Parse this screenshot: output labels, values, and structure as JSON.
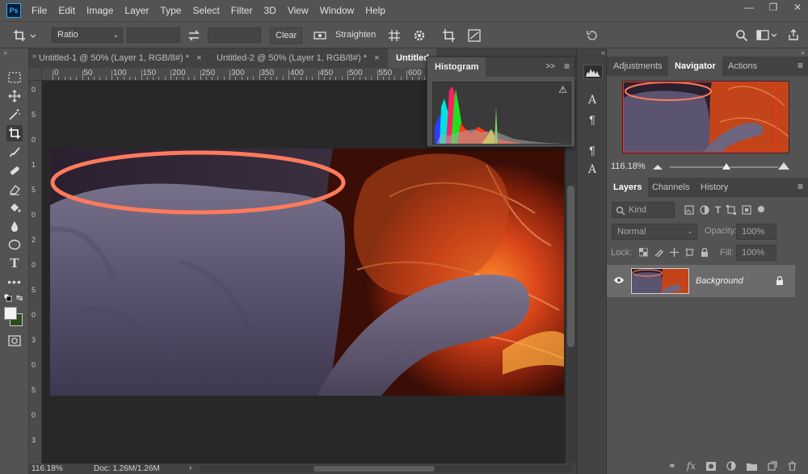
{
  "app": {
    "logo": "Ps"
  },
  "menu": [
    "File",
    "Edit",
    "Image",
    "Layer",
    "Type",
    "Select",
    "Filter",
    "3D",
    "View",
    "Window",
    "Help"
  ],
  "window_controls": [
    "minimize-icon",
    "restore-icon",
    "close-icon"
  ],
  "options": {
    "ratio_label": "Ratio",
    "clear_label": "Clear",
    "straighten_label": "Straighten"
  },
  "tabs": [
    {
      "label": "Untitled-1 @ 50% (Layer 1, RGB/8#) *",
      "close": "×"
    },
    {
      "label": "Untitled-2 @ 50% (Layer 1, RGB/8#) *",
      "close": "×"
    },
    {
      "label": "Untitled-"
    }
  ],
  "ruler": {
    "h_ticks": [
      "0",
      "50",
      "100",
      "150",
      "200",
      "250",
      "300",
      "350",
      "400",
      "450",
      "500",
      "550",
      "600"
    ],
    "v_ticks": [
      "0",
      "5",
      "0",
      "1",
      "5",
      "0",
      "2",
      "0",
      "5",
      "0",
      "3",
      "0",
      "5",
      "0",
      "3"
    ]
  },
  "histogram": {
    "tab": "Histogram",
    "expand": ">>",
    "warning": "⚠"
  },
  "status": {
    "zoom": "116.18%",
    "doc": "Doc: 1.26M/1.26M",
    "arrow": "›"
  },
  "navigator_panel": {
    "tabs": [
      "Adjustments",
      "Navigator",
      "Actions"
    ],
    "zoom": "116.18%",
    "zoom_slider": 0.52
  },
  "layers_panel": {
    "tabs": [
      "Layers",
      "Channels",
      "History"
    ],
    "kind_placeholder": "Kind",
    "blend_mode": "Normal",
    "opacity_label": "Opacity:",
    "opacity_value": "100%",
    "lock_label": "Lock:",
    "fill_label": "Fill:",
    "fill_value": "100%",
    "layer_name": "Background"
  },
  "colors": {
    "accent_red": "#ff2a2a",
    "ellipse": "#ff7a5c",
    "foreground": "#f2f2f2",
    "background": "#2f4a1f"
  }
}
